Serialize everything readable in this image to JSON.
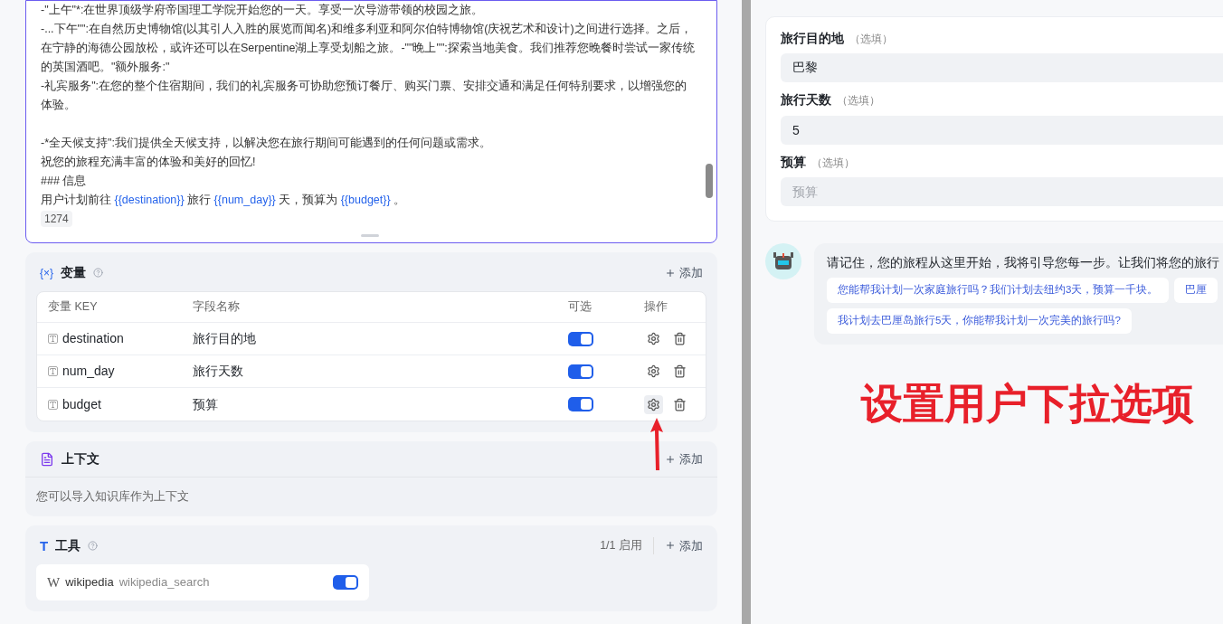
{
  "prompt_editor": {
    "lines": [
      {
        "gap_after": false,
        "segments": [
          {
            "kind": "text",
            "text": "-\"上午\"*:在世界顶级学府帝国理工学院开始您的一天。享受一次导游带领的校园之旅。"
          }
        ]
      },
      {
        "gap_after": false,
        "segments": [
          {
            "kind": "text",
            "text": "-...下午\"\":在自然历史博物馆(以其引人入胜的展览而闻名)和维多利亚和阿尔伯特博物馆(庆祝艺术和设计)之间进行选择。之后，在宁静的海德公园放松，或许还可以在Serpentine湖上享受划船之旅。-\"\"晚上\"\":探索当地美食。我们推荐您晚餐时尝试一家传统的英国酒吧。\"额外服务:\""
          }
        ]
      },
      {
        "gap_after": true,
        "segments": [
          {
            "kind": "text",
            "text": "-礼宾服务\":在您的整个住宿期间，我们的礼宾服务可协助您预订餐厅、购买门票、安排交通和满足任何特别要求，以增强您的体验。"
          }
        ]
      },
      {
        "gap_after": false,
        "segments": [
          {
            "kind": "text",
            "text": "-*全天候支持\":我们提供全天候支持，以解决您在旅行期间可能遇到的任何问题或需求。"
          }
        ]
      },
      {
        "gap_after": false,
        "segments": [
          {
            "kind": "text",
            "text": "祝您的旅程充满丰富的体验和美好的回忆!"
          }
        ]
      },
      {
        "gap_after": false,
        "segments": [
          {
            "kind": "text",
            "text": "### 信息"
          }
        ]
      },
      {
        "gap_after": false,
        "segments": [
          {
            "kind": "text",
            "text": "用户计划前往 "
          },
          {
            "kind": "var",
            "text": "{{destination}}"
          },
          {
            "kind": "text",
            "text": " 旅行 "
          },
          {
            "kind": "var",
            "text": "{{num_day}}"
          },
          {
            "kind": "text",
            "text": " 天，预算为 "
          },
          {
            "kind": "var",
            "text": "{{budget}}"
          },
          {
            "kind": "text",
            "text": " 。"
          }
        ]
      }
    ],
    "char_count": "1274"
  },
  "variables": {
    "icon": "{×}",
    "title": "变量",
    "add": "添加",
    "columns": [
      "变量 KEY",
      "字段名称",
      "可选",
      "操作"
    ],
    "rows": [
      {
        "key": "destination",
        "name": "旅行目的地",
        "on": true,
        "highlighted": false
      },
      {
        "key": "num_day",
        "name": "旅行天数",
        "on": true,
        "highlighted": false
      },
      {
        "key": "budget",
        "name": "预算",
        "on": true,
        "highlighted": true
      }
    ]
  },
  "context": {
    "title": "上下文",
    "add": "添加",
    "hint": "您可以导入知识库作为上下文"
  },
  "tools": {
    "icon": "T",
    "title": "工具",
    "count": "1/1 启用",
    "add": "添加",
    "items": [
      {
        "logo": "W",
        "name": "wikipedia",
        "detail": "wikipedia_search",
        "on": true
      }
    ]
  },
  "preview_form": {
    "fields": [
      {
        "label": "旅行目的地",
        "optional": "（选填）",
        "value": "巴黎"
      },
      {
        "label": "旅行天数",
        "optional": "（选填）",
        "value": "5"
      },
      {
        "label": "预算",
        "optional": "（选填）",
        "placeholder": "预算"
      }
    ]
  },
  "chat": {
    "message": "请记住，您的旅程从这里开始，我将引导您每一步。让我们将您的旅行",
    "suggestion_rows": [
      [
        "您能帮我计划一次家庭旅行吗？我们计划去纽约3天，预算一千块。",
        "巴厘"
      ],
      [
        "我计划去巴厘岛旅行5天，你能帮我计划一次完美的旅行吗?"
      ]
    ]
  },
  "annotation": {
    "text": "设置用户下拉选项"
  }
}
